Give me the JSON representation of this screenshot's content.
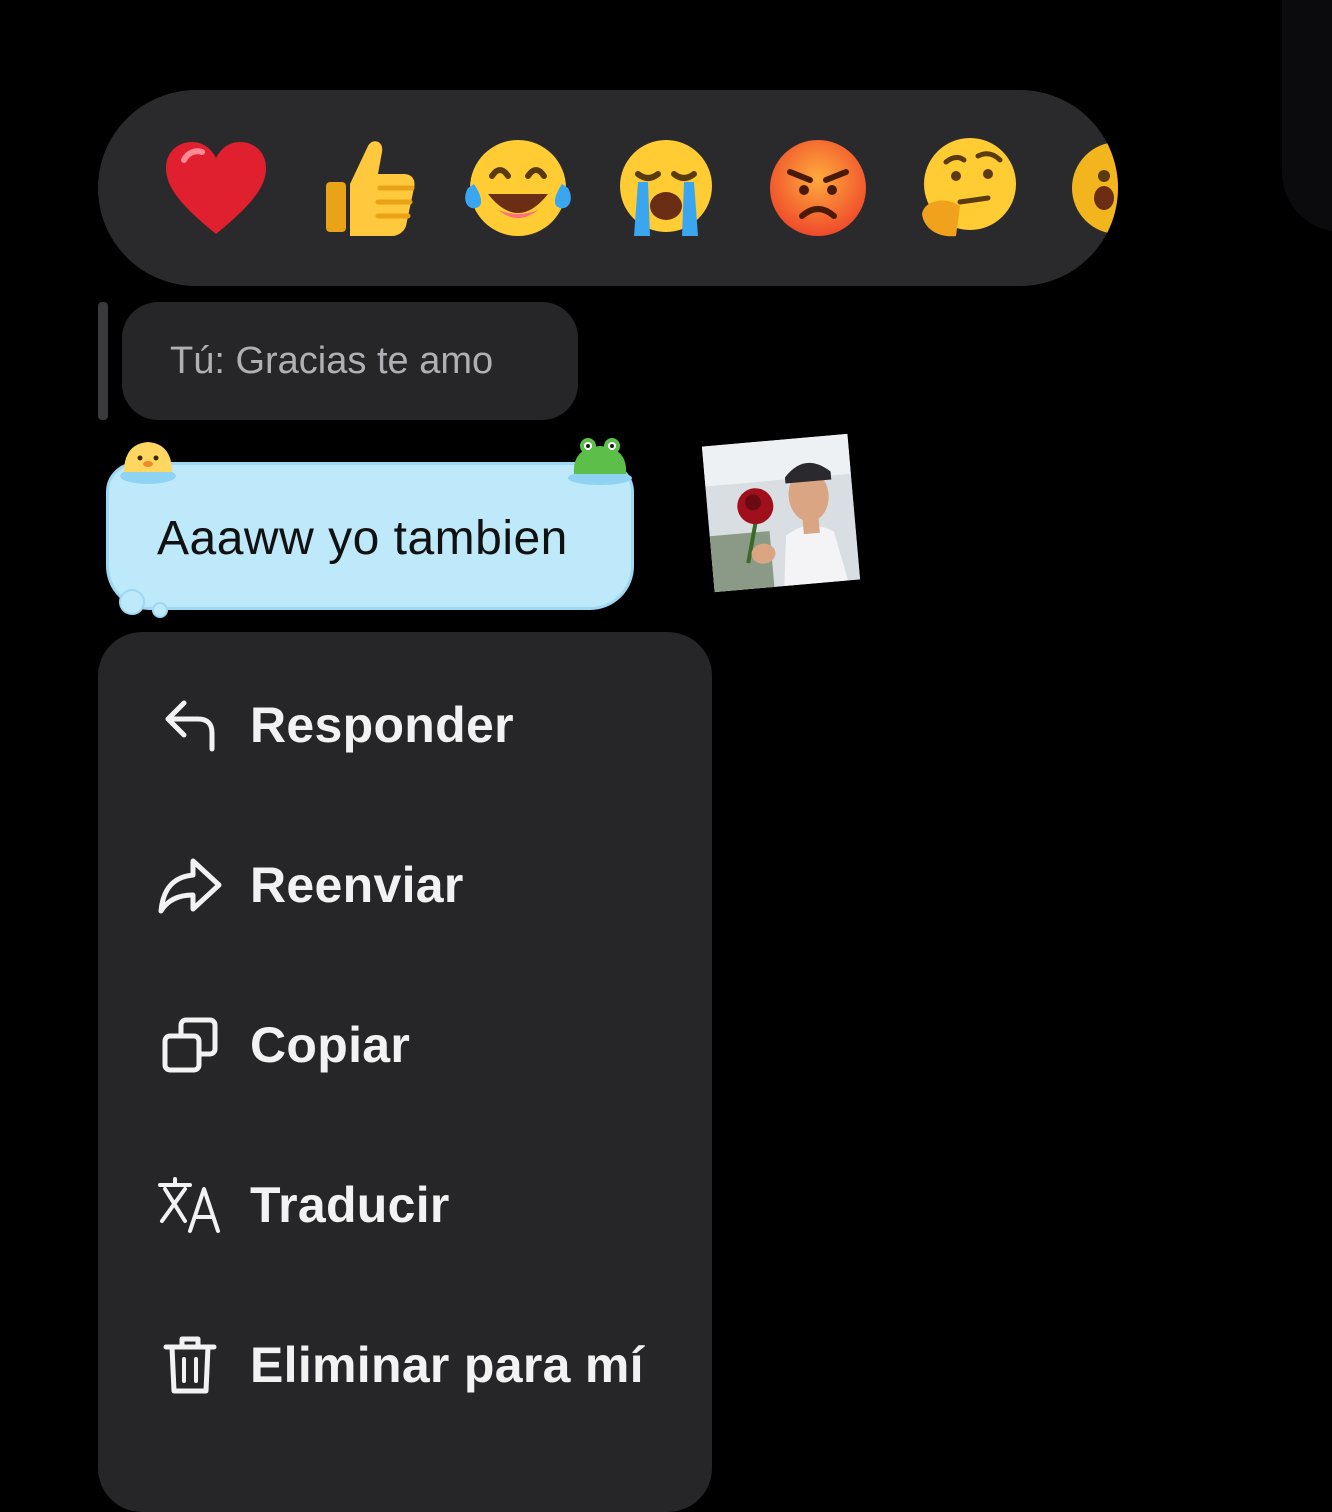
{
  "reactions": [
    {
      "icon": "red-heart-emoji"
    },
    {
      "icon": "thumbs-up-emoji"
    },
    {
      "icon": "tears-of-joy-emoji"
    },
    {
      "icon": "loudly-crying-emoji"
    },
    {
      "icon": "angry-face-emoji"
    },
    {
      "icon": "thinking-face-emoji"
    },
    {
      "icon": "surprised-face-emoji"
    }
  ],
  "reply_quote": {
    "text": "Tú: Gracias te amo"
  },
  "message": {
    "text": "Aaaww yo tambien",
    "bubble_color": "#bde9fb"
  },
  "menu": {
    "items": [
      {
        "label": "Responder",
        "icon": "reply-arrow-icon"
      },
      {
        "label": "Reenviar",
        "icon": "forward-arrow-icon"
      },
      {
        "label": "Copiar",
        "icon": "copy-icon"
      },
      {
        "label": "Traducir",
        "icon": "translate-icon"
      },
      {
        "label": "Eliminar para mí",
        "icon": "trash-icon"
      }
    ]
  },
  "colors": {
    "background": "#000000",
    "surface": "#262628",
    "reaction_bar": "#2a2a2c",
    "quote_text": "#b0b0b4"
  }
}
